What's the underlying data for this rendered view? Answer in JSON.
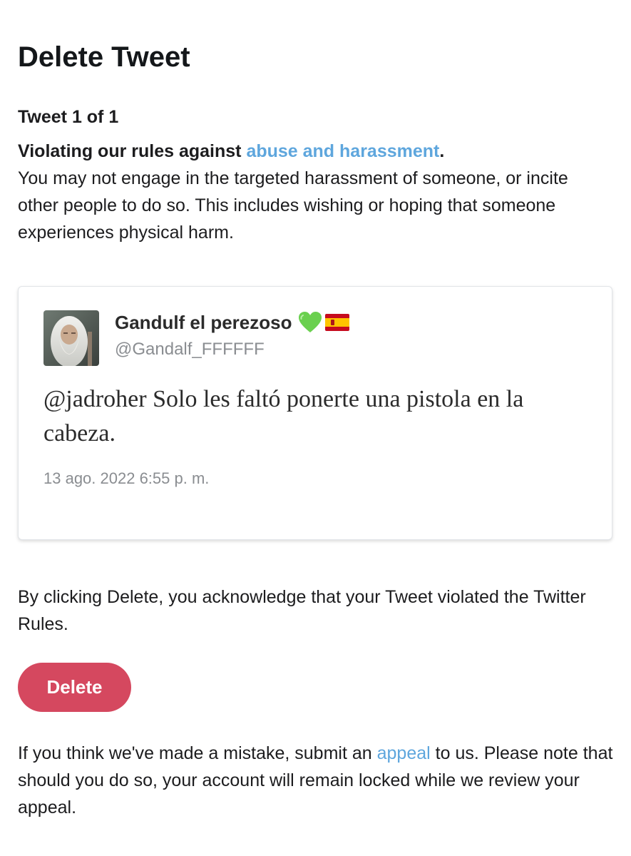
{
  "page": {
    "title": "Delete Tweet"
  },
  "tweet_count": "Tweet 1 of 1",
  "rule": {
    "heading_prefix": "Violating our rules against ",
    "heading_link": "abuse and harassment",
    "heading_suffix": ".",
    "description": "You may not engage in the targeted harassment of someone, or incite other people to do so. This includes wishing or hoping that someone experiences physical harm."
  },
  "tweet": {
    "display_name": "Gandulf el perezoso",
    "emojis": [
      "green-heart-icon",
      "spain-flag-icon"
    ],
    "handle": "@Gandalf_FFFFFF",
    "text": "@jadroher Solo les faltó ponerte una pistola en la cabeza.",
    "timestamp": "13 ago. 2022 6:55 p. m."
  },
  "acknowledgement": "By clicking Delete, you acknowledge that your Tweet violated the Twitter Rules.",
  "delete_button": {
    "label": "Delete"
  },
  "appeal": {
    "prefix": "If you think we've made a mistake, submit an ",
    "link": "appeal",
    "suffix": " to us. Please note that should you do so, your account will remain locked while we review your appeal."
  },
  "colors": {
    "link": "#5ea6dd",
    "delete_button": "#d5485f",
    "muted_text": "#8a8d91"
  }
}
